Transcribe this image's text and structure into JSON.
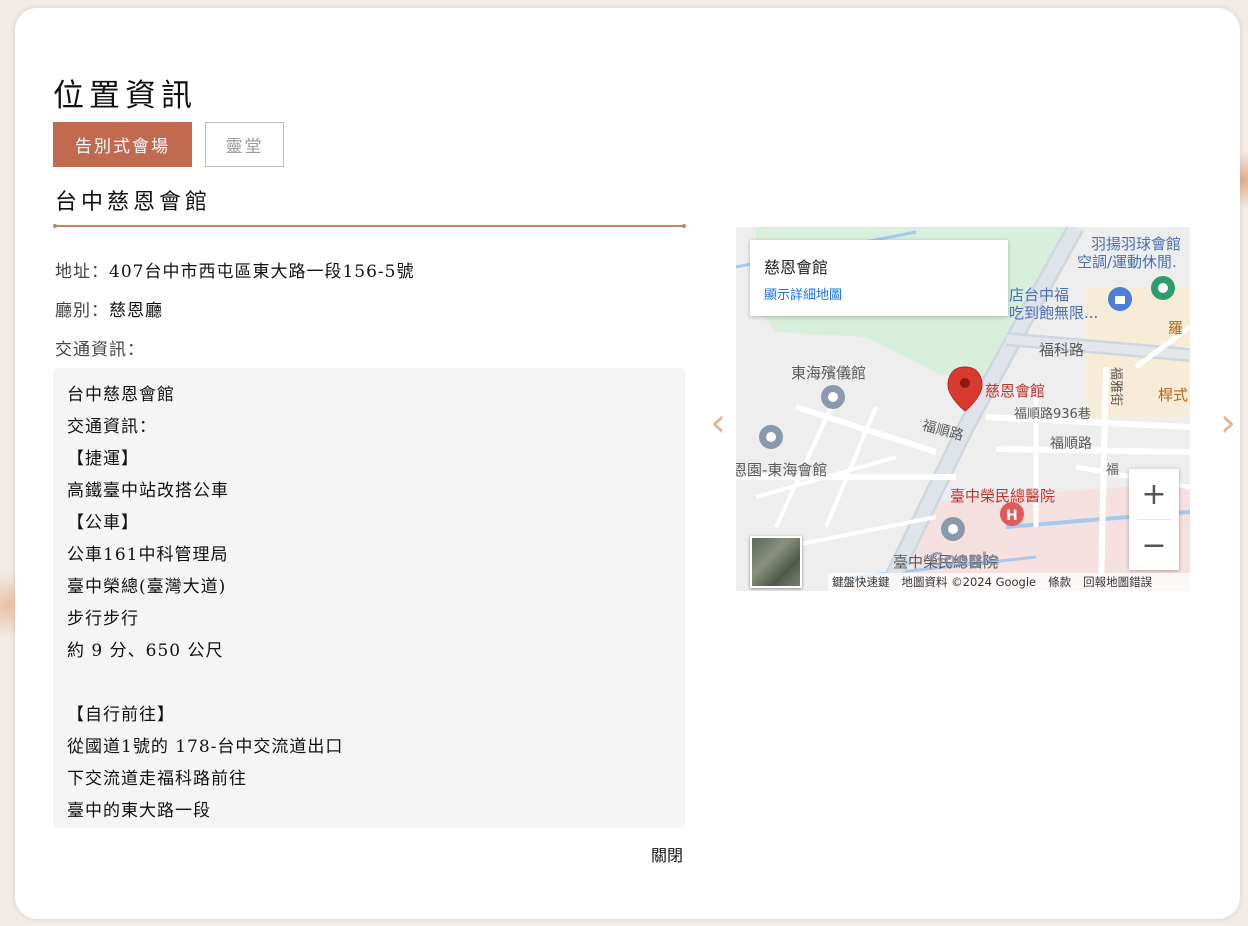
{
  "modal": {
    "title": "位置資訊",
    "tabs": [
      "告別式會場",
      "靈堂"
    ],
    "venue_name": "台中慈恩會館",
    "address_label": "地址：",
    "address_value": "407台中市西屯區東大路一段156-5號",
    "hall_label": "廳別：",
    "hall_value": "慈恩廳",
    "traffic_label": "交通資訊：",
    "traffic_lines": [
      "台中慈恩會館",
      "交通資訊：",
      "【捷運】",
      "高鐵臺中站改搭公車",
      "【公車】",
      "公車161中科管理局",
      "臺中榮總(臺灣大道)",
      "步行步行",
      "約 9 分、650 公尺",
      "",
      "【自行前往】",
      "從國道1號的 178-台中交流道出口",
      "下交流道走福科路前往",
      "臺中的東大路一段"
    ],
    "close_label": "關閉"
  },
  "map": {
    "infocard_name": "慈恩會館",
    "infocard_link": "顯示詳細地圖",
    "labels": {
      "badminton_1": "羽揚羽球會館",
      "badminton_2": "空調/運動休閒.",
      "store_1": "店台中福",
      "store_2": "吃到飽無限...",
      "fuke_road": "福科路",
      "luo": "羅",
      "tunghai_funeral": "東海殯儀館",
      "marker_label": "慈恩會館",
      "fushun_lane": "福順路936巷",
      "fushun_road_1": "福順路",
      "fushun_road_2": "福順路",
      "fuya_st": "福雅街",
      "cheng": "桿式",
      "tunghai_hall": "恩園-東海會館",
      "hospital": "臺中榮民總醫院",
      "hospital_2": "臺中榮民總醫院",
      "fu": "福"
    },
    "google_word": "Google",
    "footer": [
      "鍵盤快速鍵",
      "地圖資料 ©2024 Google",
      "條款",
      "回報地圖錯誤"
    ],
    "zoom_in": "+",
    "zoom_out": "−"
  },
  "nav": {
    "prev": "‹",
    "next": "›"
  },
  "colors": {
    "accent": "#c26a50",
    "divider": "#c9826a",
    "marker": "#d93a2f"
  }
}
